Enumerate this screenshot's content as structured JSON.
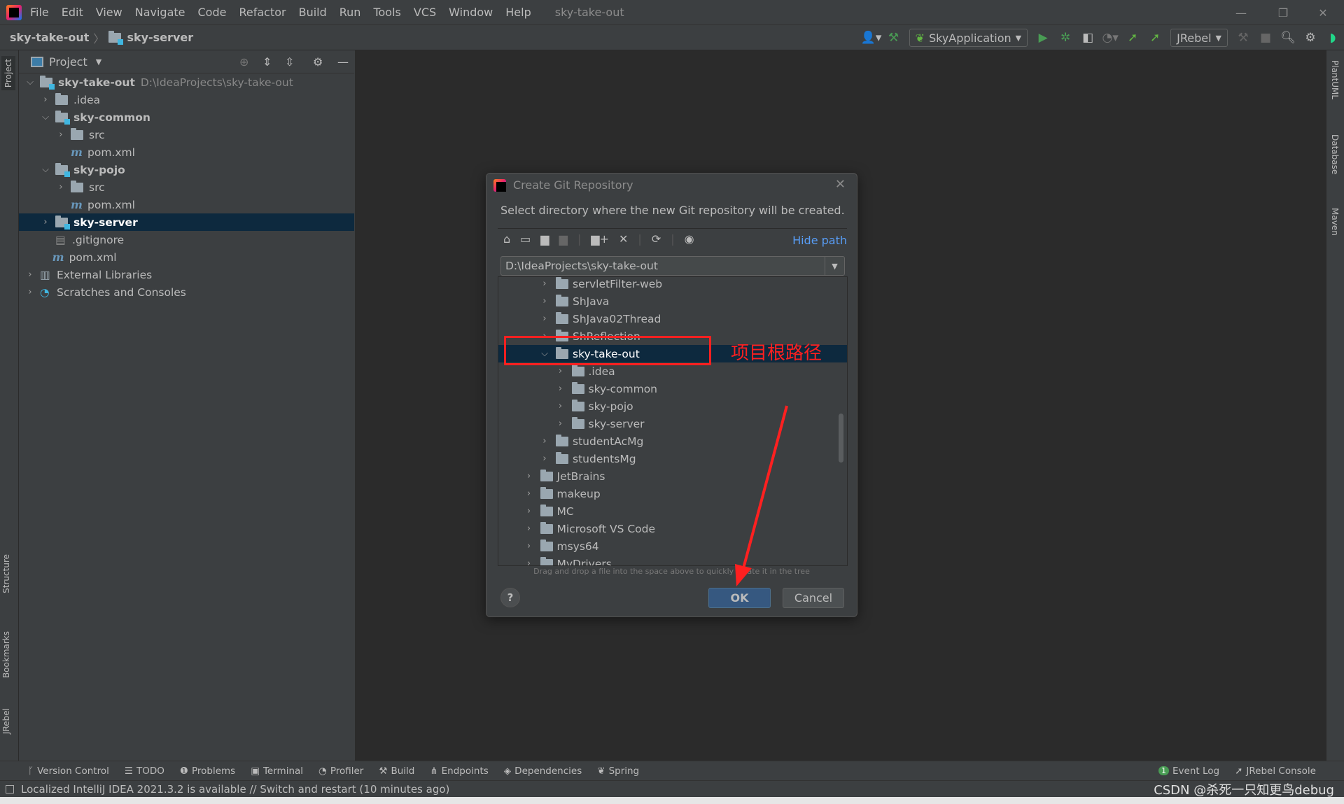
{
  "menubar": {
    "items": [
      "File",
      "Edit",
      "View",
      "Navigate",
      "Code",
      "Refactor",
      "Build",
      "Run",
      "Tools",
      "VCS",
      "Window",
      "Help"
    ],
    "window_title": "sky-take-out"
  },
  "breadcrumb": {
    "root": "sky-take-out",
    "module": "sky-server"
  },
  "toolbar": {
    "run_config": "SkyApplication",
    "jrebel": "JRebel"
  },
  "project_panel": {
    "title": "Project",
    "tree": [
      {
        "label": "sky-take-out",
        "hint": "D:\\IdeaProjects\\sky-take-out",
        "level": 0,
        "expanded": true,
        "bold": true,
        "icon": "module"
      },
      {
        "label": ".idea",
        "level": 1,
        "expanded": false,
        "icon": "folder"
      },
      {
        "label": "sky-common",
        "level": 1,
        "expanded": true,
        "bold": true,
        "icon": "module"
      },
      {
        "label": "src",
        "level": 2,
        "expanded": false,
        "icon": "folder"
      },
      {
        "label": "pom.xml",
        "level": 2,
        "icon": "maven"
      },
      {
        "label": "sky-pojo",
        "level": 1,
        "expanded": true,
        "bold": true,
        "icon": "module"
      },
      {
        "label": "src",
        "level": 2,
        "expanded": false,
        "icon": "folder"
      },
      {
        "label": "pom.xml",
        "level": 2,
        "icon": "maven"
      },
      {
        "label": "sky-server",
        "level": 1,
        "expanded": false,
        "bold": true,
        "icon": "module",
        "selected": true
      },
      {
        "label": ".gitignore",
        "level": 1,
        "icon": "file"
      },
      {
        "label": "pom.xml",
        "level": 0.8,
        "icon": "maven"
      },
      {
        "label": "External Libraries",
        "level": 0,
        "expanded": false,
        "icon": "library"
      },
      {
        "label": "Scratches and Consoles",
        "level": 0,
        "expanded": false,
        "icon": "scratch"
      }
    ]
  },
  "side_tabs": {
    "left": [
      "Project",
      "Structure",
      "Bookmarks",
      "JRebel"
    ],
    "right": [
      "PlantUML",
      "Database",
      "Maven"
    ]
  },
  "dialog": {
    "title": "Create Git Repository",
    "description": "Select directory where the new Git repository will be created.",
    "hide_path": "Hide path",
    "path_value": "D:\\IdeaProjects\\sky-take-out",
    "tree": [
      {
        "label": "servletFilter-web",
        "level": 2,
        "expanded": false
      },
      {
        "label": "ShJava",
        "level": 2,
        "expanded": false
      },
      {
        "label": "ShJava02Thread",
        "level": 2,
        "expanded": false
      },
      {
        "label": "ShReflection",
        "level": 2,
        "expanded": false
      },
      {
        "label": "sky-take-out",
        "level": 2,
        "expanded": true,
        "selected": true
      },
      {
        "label": ".idea",
        "level": 3,
        "expanded": false
      },
      {
        "label": "sky-common",
        "level": 3,
        "expanded": false
      },
      {
        "label": "sky-pojo",
        "level": 3,
        "expanded": false
      },
      {
        "label": "sky-server",
        "level": 3,
        "expanded": false
      },
      {
        "label": "studentAcMg",
        "level": 2,
        "expanded": false
      },
      {
        "label": "studentsMg",
        "level": 2,
        "expanded": false
      },
      {
        "label": "JetBrains",
        "level": 1,
        "expanded": false
      },
      {
        "label": "makeup",
        "level": 1,
        "expanded": false
      },
      {
        "label": "MC",
        "level": 1,
        "expanded": false
      },
      {
        "label": "Microsoft VS Code",
        "level": 1,
        "expanded": false
      },
      {
        "label": "msys64",
        "level": 1,
        "expanded": false
      },
      {
        "label": "MyDrivers",
        "level": 1,
        "expanded": false
      }
    ],
    "drag_hint": "Drag and drop a file into the space above to quickly locate it in the tree",
    "ok": "OK",
    "cancel": "Cancel",
    "help": "?",
    "annotation": "项目根路径",
    "annotation_color": "#ff2020"
  },
  "tool_windows": {
    "left": [
      "Version Control",
      "TODO",
      "Problems",
      "Terminal",
      "Profiler",
      "Build",
      "Endpoints",
      "Dependencies",
      "Spring"
    ],
    "right": [
      "Event Log",
      "JRebel Console"
    ],
    "event_count": "1"
  },
  "status": {
    "message": "Localized IntelliJ IDEA 2021.3.2 is available // Switch and restart (10 minutes ago)",
    "watermark": "CSDN @杀死一只知更鸟debug"
  },
  "colors": {
    "selection": "#0d293e",
    "accent_link": "#589df6",
    "ok_button": "#365880",
    "run_green": "#499c54"
  }
}
